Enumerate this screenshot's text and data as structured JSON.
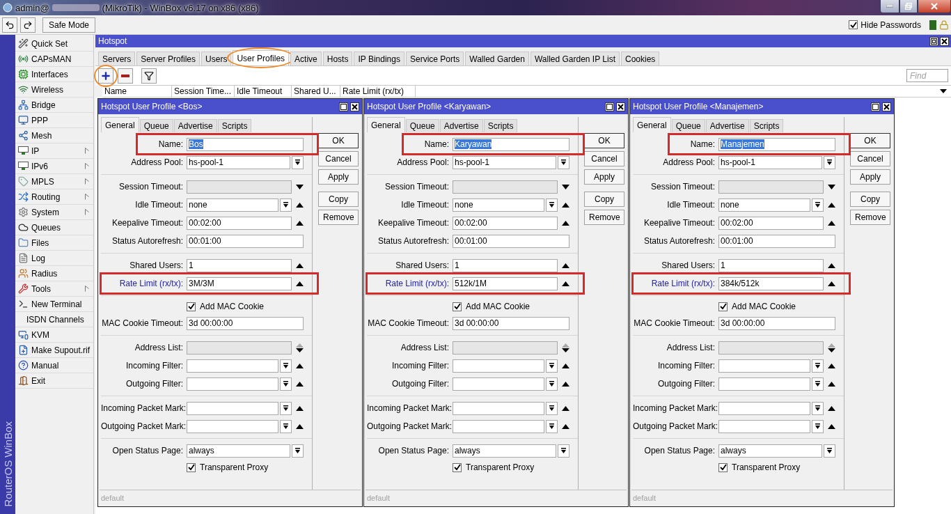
{
  "window": {
    "title_user": "admin@",
    "title_rest": "(MikroTik) - WinBox v6.17 on x86 (x86)"
  },
  "toolbar": {
    "safe_mode": "Safe Mode",
    "hide_passwords": {
      "label": "Hide Passwords",
      "checked": true
    }
  },
  "side_brand": "RouterOS WinBox",
  "sidebar": {
    "items": [
      {
        "label": "Quick Set",
        "submenu": false
      },
      {
        "label": "CAPsMAN",
        "submenu": false
      },
      {
        "label": "Interfaces",
        "submenu": false
      },
      {
        "label": "Wireless",
        "submenu": false
      },
      {
        "label": "Bridge",
        "submenu": false
      },
      {
        "label": "PPP",
        "submenu": false
      },
      {
        "label": "Mesh",
        "submenu": false
      },
      {
        "label": "IP",
        "submenu": true
      },
      {
        "label": "IPv6",
        "submenu": true
      },
      {
        "label": "MPLS",
        "submenu": true
      },
      {
        "label": "Routing",
        "submenu": true
      },
      {
        "label": "System",
        "submenu": true
      },
      {
        "label": "Queues",
        "submenu": false
      },
      {
        "label": "Files",
        "submenu": false
      },
      {
        "label": "Log",
        "submenu": false
      },
      {
        "label": "Radius",
        "submenu": false
      },
      {
        "label": "Tools",
        "submenu": true
      },
      {
        "label": "New Terminal",
        "submenu": false
      },
      {
        "label": "ISDN Channels",
        "submenu": false
      },
      {
        "label": "KVM",
        "submenu": false
      },
      {
        "label": "Make Supout.rif",
        "submenu": false
      },
      {
        "label": "Manual",
        "submenu": false
      },
      {
        "label": "Exit",
        "submenu": false
      }
    ]
  },
  "hotspot": {
    "title": "Hotspot",
    "tabs": [
      {
        "label": "Servers",
        "selected": false,
        "circled": false
      },
      {
        "label": "Server Profiles",
        "selected": false,
        "circled": false
      },
      {
        "label": "Users",
        "selected": false,
        "circled": false
      },
      {
        "label": "User Profiles",
        "selected": true,
        "circled": true
      },
      {
        "label": "Active",
        "selected": false,
        "circled": false
      },
      {
        "label": "Hosts",
        "selected": false,
        "circled": false
      },
      {
        "label": "IP Bindings",
        "selected": false,
        "circled": false
      },
      {
        "label": "Service Ports",
        "selected": false,
        "circled": false
      },
      {
        "label": "Walled Garden",
        "selected": false,
        "circled": false
      },
      {
        "label": "Walled Garden IP List",
        "selected": false,
        "circled": false
      },
      {
        "label": "Cookies",
        "selected": false,
        "circled": false
      }
    ],
    "add_circled": true,
    "find_placeholder": "Find",
    "columns": [
      "Name",
      "Session Time...",
      "Idle Timeout",
      "Shared U...",
      "Rate Limit (rx/tx)"
    ]
  },
  "dialogs": [
    {
      "title": "Hotspot User Profile <Bos>",
      "tabs": [
        {
          "label": "General",
          "selected": true
        },
        {
          "label": "Queue",
          "selected": false
        },
        {
          "label": "Advertise",
          "selected": false
        },
        {
          "label": "Scripts",
          "selected": false
        }
      ],
      "buttons": [
        "OK",
        "Cancel",
        "Apply",
        "Copy",
        "Remove"
      ],
      "status": "default",
      "sections": [
        [
          {
            "kind": "field",
            "label": "Name:",
            "value": "Bos",
            "text_selected": true,
            "highlighted": true,
            "modified": false,
            "disabled": false
          },
          {
            "kind": "field",
            "label": "Address Pool:",
            "value": "hs-pool-1",
            "dropdown": true,
            "highlighted": false,
            "modified": false,
            "disabled": false
          }
        ],
        [
          {
            "kind": "field",
            "label": "Session Timeout:",
            "arrow_down": true,
            "highlighted": false,
            "modified": false,
            "disabled": true
          },
          {
            "kind": "field",
            "label": "Idle Timeout:",
            "value": "none",
            "dropdown": true,
            "arrow_up": true,
            "highlighted": false,
            "modified": false,
            "disabled": false
          },
          {
            "kind": "field",
            "label": "Keepalive Timeout:",
            "value": "00:02:00",
            "arrow_up": true,
            "highlighted": false,
            "modified": false,
            "disabled": false
          },
          {
            "kind": "field",
            "label": "Status Autorefresh:",
            "value": "00:01:00",
            "highlighted": false,
            "modified": false,
            "disabled": false
          }
        ],
        [
          {
            "kind": "field",
            "label": "Shared Users:",
            "value": "1",
            "arrow_up": true,
            "highlighted": false,
            "modified": false,
            "disabled": false
          },
          {
            "kind": "field",
            "label": "Rate Limit (rx/tx):",
            "value": "3M/3M",
            "arrow_up": true,
            "highlighted": true,
            "modified": true,
            "disabled": false
          }
        ],
        [
          {
            "kind": "checkbox",
            "label": "Add MAC Cookie",
            "checked": true
          },
          {
            "kind": "field",
            "label": "MAC Cookie Timeout:",
            "value": "3d 00:00:00",
            "highlighted": false,
            "modified": false,
            "disabled": false
          }
        ],
        [
          {
            "kind": "field",
            "label": "Address List:",
            "arrow_up": true,
            "arrow_down": true,
            "highlighted": false,
            "modified": false,
            "disabled": true
          },
          {
            "kind": "field",
            "label": "Incoming Filter:",
            "dropdown": true,
            "arrow_up": true,
            "highlighted": false,
            "modified": false,
            "disabled": false
          },
          {
            "kind": "field",
            "label": "Outgoing Filter:",
            "dropdown": true,
            "arrow_up": true,
            "highlighted": false,
            "modified": false,
            "disabled": false
          }
        ],
        [
          {
            "kind": "field",
            "label": "Incoming Packet Mark:",
            "dropdown": true,
            "arrow_up": true,
            "highlighted": false,
            "modified": false,
            "disabled": false
          },
          {
            "kind": "field",
            "label": "Outgoing Packet Mark:",
            "dropdown": true,
            "arrow_up": true,
            "highlighted": false,
            "modified": false,
            "disabled": false
          }
        ],
        [
          {
            "kind": "field",
            "label": "Open Status Page:",
            "value": "always",
            "dropdown": true,
            "highlighted": false,
            "modified": false,
            "disabled": false
          },
          {
            "kind": "checkbox",
            "label": "Transparent Proxy",
            "checked": true
          }
        ]
      ]
    },
    {
      "title": "Hotspot User Profile <Karyawan>",
      "tabs": [
        {
          "label": "General",
          "selected": true
        },
        {
          "label": "Queue",
          "selected": false
        },
        {
          "label": "Advertise",
          "selected": false
        },
        {
          "label": "Scripts",
          "selected": false
        }
      ],
      "buttons": [
        "OK",
        "Cancel",
        "Apply",
        "Copy",
        "Remove"
      ],
      "status": "default",
      "sections": [
        [
          {
            "kind": "field",
            "label": "Name:",
            "value": "Karyawan",
            "text_selected": true,
            "highlighted": true,
            "modified": false,
            "disabled": false
          },
          {
            "kind": "field",
            "label": "Address Pool:",
            "value": "hs-pool-1",
            "dropdown": true,
            "highlighted": false,
            "modified": false,
            "disabled": false
          }
        ],
        [
          {
            "kind": "field",
            "label": "Session Timeout:",
            "arrow_down": true,
            "highlighted": false,
            "modified": false,
            "disabled": true
          },
          {
            "kind": "field",
            "label": "Idle Timeout:",
            "value": "none",
            "dropdown": true,
            "arrow_up": true,
            "highlighted": false,
            "modified": false,
            "disabled": false
          },
          {
            "kind": "field",
            "label": "Keepalive Timeout:",
            "value": "00:02:00",
            "arrow_up": true,
            "highlighted": false,
            "modified": false,
            "disabled": false
          },
          {
            "kind": "field",
            "label": "Status Autorefresh:",
            "value": "00:01:00",
            "highlighted": false,
            "modified": false,
            "disabled": false
          }
        ],
        [
          {
            "kind": "field",
            "label": "Shared Users:",
            "value": "1",
            "arrow_up": true,
            "highlighted": false,
            "modified": false,
            "disabled": false
          },
          {
            "kind": "field",
            "label": "Rate Limit (rx/tx):",
            "value": "512k/1M",
            "arrow_up": true,
            "highlighted": true,
            "modified": true,
            "disabled": false
          }
        ],
        [
          {
            "kind": "checkbox",
            "label": "Add MAC Cookie",
            "checked": true
          },
          {
            "kind": "field",
            "label": "MAC Cookie Timeout:",
            "value": "3d 00:00:00",
            "highlighted": false,
            "modified": false,
            "disabled": false
          }
        ],
        [
          {
            "kind": "field",
            "label": "Address List:",
            "arrow_up": true,
            "arrow_down": true,
            "highlighted": false,
            "modified": false,
            "disabled": true
          },
          {
            "kind": "field",
            "label": "Incoming Filter:",
            "dropdown": true,
            "arrow_up": true,
            "highlighted": false,
            "modified": false,
            "disabled": false
          },
          {
            "kind": "field",
            "label": "Outgoing Filter:",
            "dropdown": true,
            "arrow_up": true,
            "highlighted": false,
            "modified": false,
            "disabled": false
          }
        ],
        [
          {
            "kind": "field",
            "label": "Incoming Packet Mark:",
            "dropdown": true,
            "arrow_up": true,
            "highlighted": false,
            "modified": false,
            "disabled": false
          },
          {
            "kind": "field",
            "label": "Outgoing Packet Mark:",
            "dropdown": true,
            "arrow_up": true,
            "highlighted": false,
            "modified": false,
            "disabled": false
          }
        ],
        [
          {
            "kind": "field",
            "label": "Open Status Page:",
            "value": "always",
            "dropdown": true,
            "highlighted": false,
            "modified": false,
            "disabled": false
          },
          {
            "kind": "checkbox",
            "label": "Transparent Proxy",
            "checked": true
          }
        ]
      ]
    },
    {
      "title": "Hotspot User Profile <Manajemen>",
      "tabs": [
        {
          "label": "General",
          "selected": true
        },
        {
          "label": "Queue",
          "selected": false
        },
        {
          "label": "Advertise",
          "selected": false
        },
        {
          "label": "Scripts",
          "selected": false
        }
      ],
      "buttons": [
        "OK",
        "Cancel",
        "Apply",
        "Copy",
        "Remove"
      ],
      "status": "default",
      "sections": [
        [
          {
            "kind": "field",
            "label": "Name:",
            "value": "Manajemen",
            "text_selected": true,
            "highlighted": true,
            "modified": false,
            "disabled": false
          },
          {
            "kind": "field",
            "label": "Address Pool:",
            "value": "hs-pool-1",
            "dropdown": true,
            "highlighted": false,
            "modified": false,
            "disabled": false
          }
        ],
        [
          {
            "kind": "field",
            "label": "Session Timeout:",
            "arrow_down": true,
            "highlighted": false,
            "modified": false,
            "disabled": true
          },
          {
            "kind": "field",
            "label": "Idle Timeout:",
            "value": "none",
            "dropdown": true,
            "arrow_up": true,
            "highlighted": false,
            "modified": false,
            "disabled": false
          },
          {
            "kind": "field",
            "label": "Keepalive Timeout:",
            "value": "00:02:00",
            "arrow_up": true,
            "highlighted": false,
            "modified": false,
            "disabled": false
          },
          {
            "kind": "field",
            "label": "Status Autorefresh:",
            "value": "00:01:00",
            "highlighted": false,
            "modified": false,
            "disabled": false
          }
        ],
        [
          {
            "kind": "field",
            "label": "Shared Users:",
            "value": "1",
            "arrow_up": true,
            "highlighted": false,
            "modified": false,
            "disabled": false
          },
          {
            "kind": "field",
            "label": "Rate Limit (rx/tx):",
            "value": "384k/512k",
            "arrow_up": true,
            "highlighted": true,
            "modified": true,
            "disabled": false
          }
        ],
        [
          {
            "kind": "checkbox",
            "label": "Add MAC Cookie",
            "checked": true
          },
          {
            "kind": "field",
            "label": "MAC Cookie Timeout:",
            "value": "3d 00:00:00",
            "highlighted": false,
            "modified": false,
            "disabled": false
          }
        ],
        [
          {
            "kind": "field",
            "label": "Address List:",
            "arrow_up": true,
            "arrow_down": true,
            "highlighted": false,
            "modified": false,
            "disabled": true
          },
          {
            "kind": "field",
            "label": "Incoming Filter:",
            "dropdown": true,
            "arrow_up": true,
            "highlighted": false,
            "modified": false,
            "disabled": false
          },
          {
            "kind": "field",
            "label": "Outgoing Filter:",
            "dropdown": true,
            "arrow_up": true,
            "highlighted": false,
            "modified": false,
            "disabled": false
          }
        ],
        [
          {
            "kind": "field",
            "label": "Incoming Packet Mark:",
            "dropdown": true,
            "arrow_up": true,
            "highlighted": false,
            "modified": false,
            "disabled": false
          },
          {
            "kind": "field",
            "label": "Outgoing Packet Mark:",
            "dropdown": true,
            "arrow_up": true,
            "highlighted": false,
            "modified": false,
            "disabled": false
          }
        ],
        [
          {
            "kind": "field",
            "label": "Open Status Page:",
            "value": "always",
            "dropdown": true,
            "highlighted": false,
            "modified": false,
            "disabled": false
          },
          {
            "kind": "checkbox",
            "label": "Transparent Proxy",
            "checked": true
          }
        ]
      ]
    }
  ]
}
